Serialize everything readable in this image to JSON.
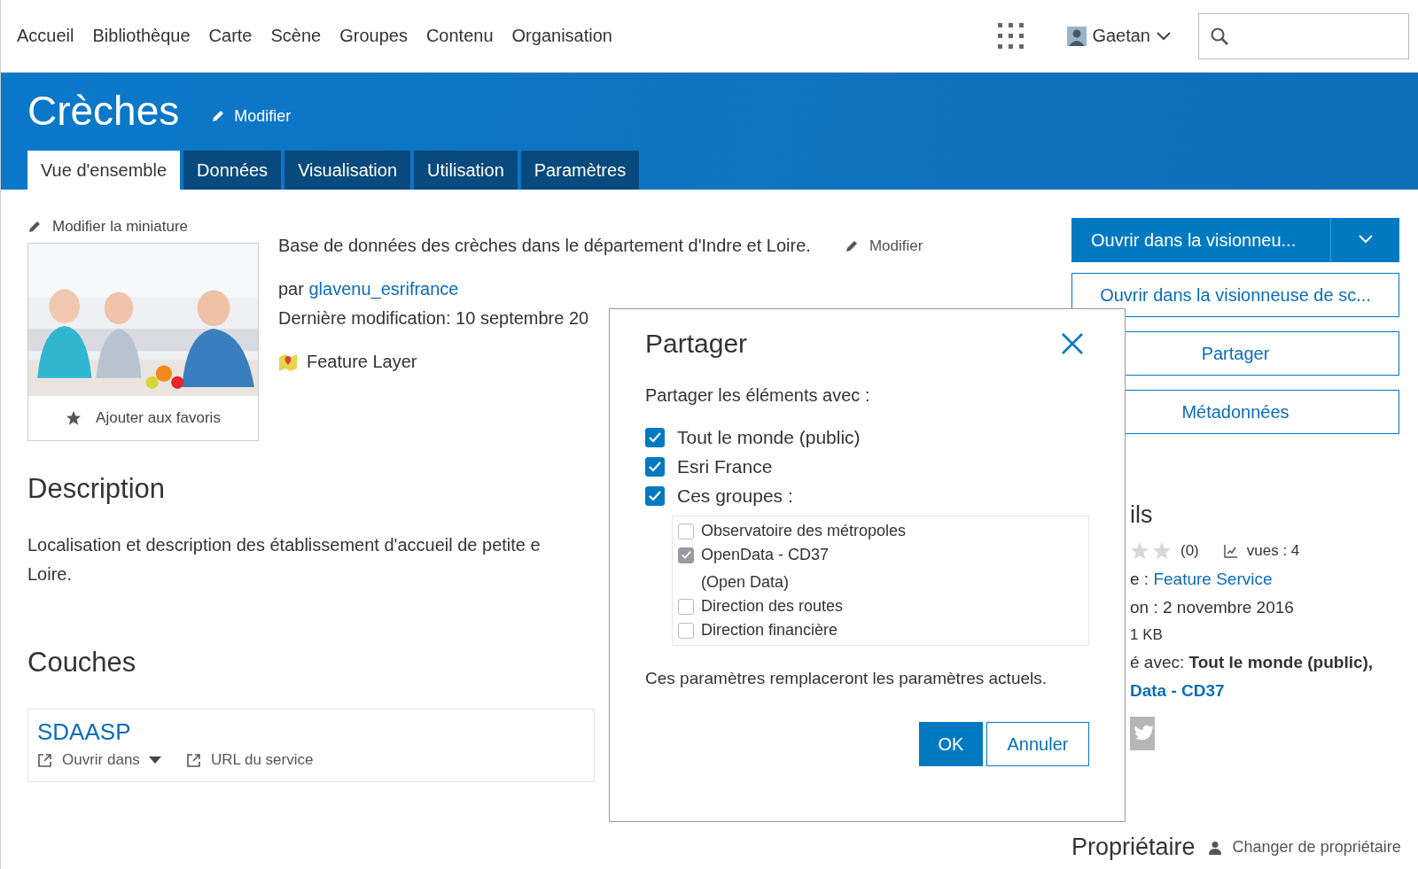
{
  "nav": {
    "items": [
      "Accueil",
      "Bibliothèque",
      "Carte",
      "Scène",
      "Groupes",
      "Contenu",
      "Organisation"
    ],
    "user": "Gaetan"
  },
  "header": {
    "title": "Crèches",
    "edit": "Modifier",
    "tabs": [
      {
        "label": "Vue d'ensemble",
        "selected": true
      },
      {
        "label": "Données",
        "selected": false
      },
      {
        "label": "Visualisation",
        "selected": false
      },
      {
        "label": "Utilisation",
        "selected": false
      },
      {
        "label": "Paramètres",
        "selected": false
      }
    ]
  },
  "thumbnail": {
    "edit": "Modifier la miniature",
    "favorite": "Ajouter aux favoris"
  },
  "summary": {
    "text": "Base de données des crèches dans le département d'Indre et Loire.",
    "edit": "Modifier",
    "by_prefix": "par",
    "owner": "glavenu_esrifrance",
    "modified": "Dernière modification: 10 septembre 20",
    "type": "Feature Layer"
  },
  "description": {
    "heading": "Description",
    "lines": [
      "Localisation et description des établissement d'accueil de petite e",
      "Loire."
    ]
  },
  "layers": {
    "heading": "Couches",
    "items": [
      {
        "name": "SDAASP",
        "open": "Ouvrir dans",
        "url": "URL du service"
      }
    ]
  },
  "actions": {
    "primary": "Ouvrir dans la visionneu...",
    "buttons": [
      "Ouvrir dans la visionneuse de sc...",
      "Partager",
      "Métadonnées"
    ]
  },
  "details": {
    "heading": "ils",
    "rating": "(0)",
    "views": "vues : 4",
    "type_prefix": "e :",
    "type": "Feature Service",
    "created": "on : 2 novembre 2016",
    "size": "1 KB",
    "shared_prefix": "é avec:",
    "shared_bold": "Tout le monde (public),",
    "shared_link": "Data - CD37"
  },
  "owner": {
    "heading": "Propriétaire",
    "change": "Changer de propriétaire"
  },
  "dialog": {
    "title": "Partager",
    "prompt": "Partager les éléments avec :",
    "options": [
      {
        "label": "Tout le monde (public)",
        "checked": true
      },
      {
        "label": "Esri France",
        "checked": true
      },
      {
        "label": "Ces groupes :",
        "checked": true
      }
    ],
    "groups": [
      {
        "label": "Observatoire des métropoles",
        "checked": false,
        "disabled": false
      },
      {
        "label": "OpenData - CD37",
        "note": "(Open Data)",
        "checked": true,
        "disabled": true
      },
      {
        "label": "Direction des routes",
        "checked": false,
        "disabled": false
      },
      {
        "label": "Direction financière",
        "checked": false,
        "disabled": false
      }
    ],
    "notice": "Ces paramètres remplaceront les paramètres actuels.",
    "ok": "OK",
    "cancel": "Annuler"
  }
}
